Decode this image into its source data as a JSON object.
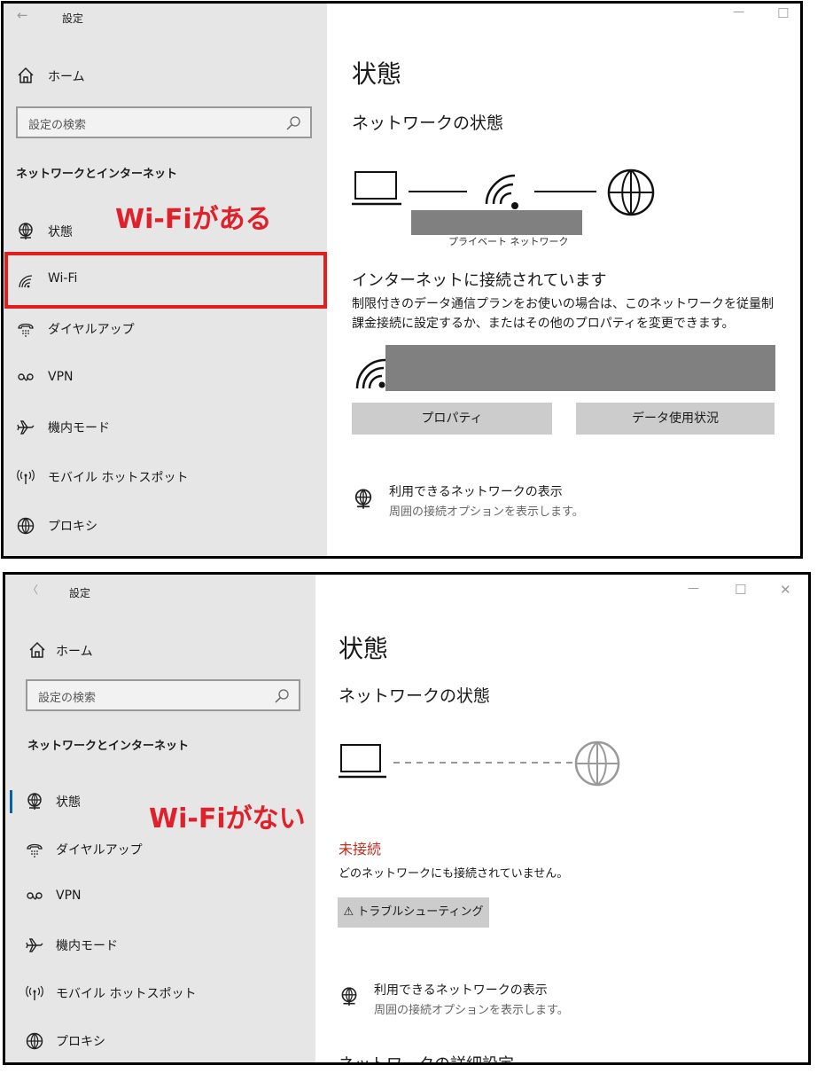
{
  "top": {
    "window": {
      "back": "←",
      "title": "設定",
      "controls": {
        "minimize": "—",
        "maximize": "☐"
      }
    },
    "sidebar": {
      "home": "ホーム",
      "search_placeholder": "設定の検索",
      "category": "ネットワークとインターネット",
      "items": [
        {
          "label": "状態",
          "icon": "globe-monitor-icon"
        },
        {
          "label": "Wi-Fi",
          "icon": "wifi-icon"
        },
        {
          "label": "ダイヤルアップ",
          "icon": "dialup-icon"
        },
        {
          "label": "VPN",
          "icon": "vpn-icon"
        },
        {
          "label": "機内モード",
          "icon": "airplane-icon"
        },
        {
          "label": "モバイル ホットスポット",
          "icon": "hotspot-icon"
        },
        {
          "label": "プロキシ",
          "icon": "globe-icon"
        }
      ]
    },
    "annotation": "Wi-Fiがある",
    "main": {
      "title": "状態",
      "section": "ネットワークの状態",
      "network_label": "プライベート ネットワーク",
      "connected_title": "インターネットに接続されています",
      "connected_desc": "制限付きのデータ通信プランをお使いの場合は、このネットワークを従量制課金接続に設定するか、またはその他のプロパティを変更できます。",
      "buttons": {
        "properties": "プロパティ",
        "data_usage": "データ使用状況"
      },
      "show_networks_title": "利用できるネットワークの表示",
      "show_networks_sub": "周囲の接続オプションを表示します。"
    }
  },
  "bottom": {
    "window": {
      "back": "〈",
      "title": "設定",
      "controls": {
        "minimize": "—",
        "maximize": "☐",
        "close": "✕"
      }
    },
    "sidebar": {
      "home": "ホーム",
      "search_placeholder": "設定の検索",
      "category": "ネットワークとインターネット",
      "items": [
        {
          "label": "状態",
          "icon": "globe-monitor-icon"
        },
        {
          "label": "ダイヤルアップ",
          "icon": "dialup-icon"
        },
        {
          "label": "VPN",
          "icon": "vpn-icon"
        },
        {
          "label": "機内モード",
          "icon": "airplane-icon"
        },
        {
          "label": "モバイル ホットスポット",
          "icon": "hotspot-icon"
        },
        {
          "label": "プロキシ",
          "icon": "globe-icon"
        }
      ]
    },
    "annotation": "Wi-Fiがない",
    "main": {
      "title": "状態",
      "section": "ネットワークの状態",
      "status_title": "未接続",
      "status_desc": "どのネットワークにも接続されていません。",
      "troubleshoot": "トラブルシューティング",
      "troubleshoot_icon": "⚠",
      "show_networks_title": "利用できるネットワークの表示",
      "show_networks_sub": "周囲の接続オプションを表示します。",
      "advanced_title": "ネットワークの詳細設定"
    }
  },
  "colors": {
    "accent": "#0063b1",
    "annotation": "#e0202a",
    "error": "#c42b1c",
    "sidebar_bg": "#e6e6e6",
    "redact": "#808080"
  }
}
